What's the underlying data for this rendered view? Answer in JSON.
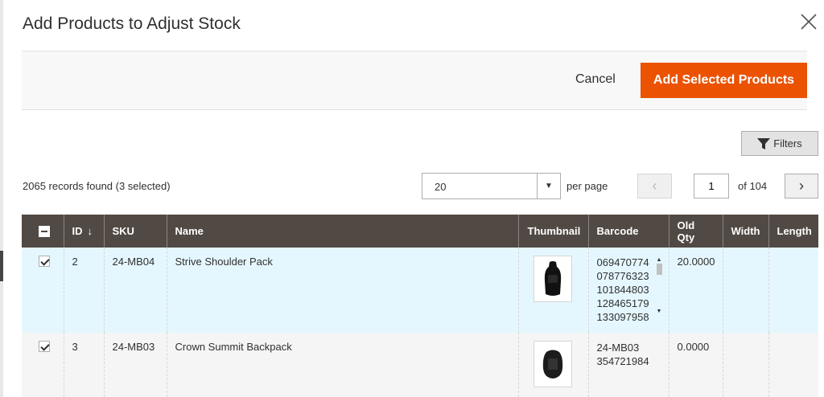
{
  "modal": {
    "title": "Add Products to Adjust Stock",
    "cancel_label": "Cancel",
    "add_label": "Add Selected Products",
    "filters_label": "Filters"
  },
  "toolbar": {
    "records": "2065 records found (3 selected)",
    "per_page_value": "20",
    "per_page_label": "per page",
    "page_value": "1",
    "of_pages": "of 104"
  },
  "columns": {
    "id": "ID",
    "sort_indicator": "↓",
    "sku": "SKU",
    "name": "Name",
    "thumbnail": "Thumbnail",
    "barcode": "Barcode",
    "old_qty": "Old Qty",
    "width": "Width",
    "length": "Length"
  },
  "rows": [
    {
      "checked": true,
      "id": "2",
      "sku": "24-MB04",
      "name": "Strive Shoulder Pack",
      "barcodes": [
        "069470774",
        "078776323",
        "101844803",
        "128465179",
        "133097958"
      ],
      "old_qty": "20.0000",
      "width": "",
      "length": ""
    },
    {
      "checked": true,
      "id": "3",
      "sku": "24-MB03",
      "name": "Crown Summit Backpack",
      "barcodes": [
        "24-MB03",
        "354721984"
      ],
      "old_qty": "0.0000",
      "width": "",
      "length": ""
    }
  ],
  "colors": {
    "header_bg": "#514943",
    "primary": "#eb5202",
    "selected_row": "#e5f7fe"
  }
}
